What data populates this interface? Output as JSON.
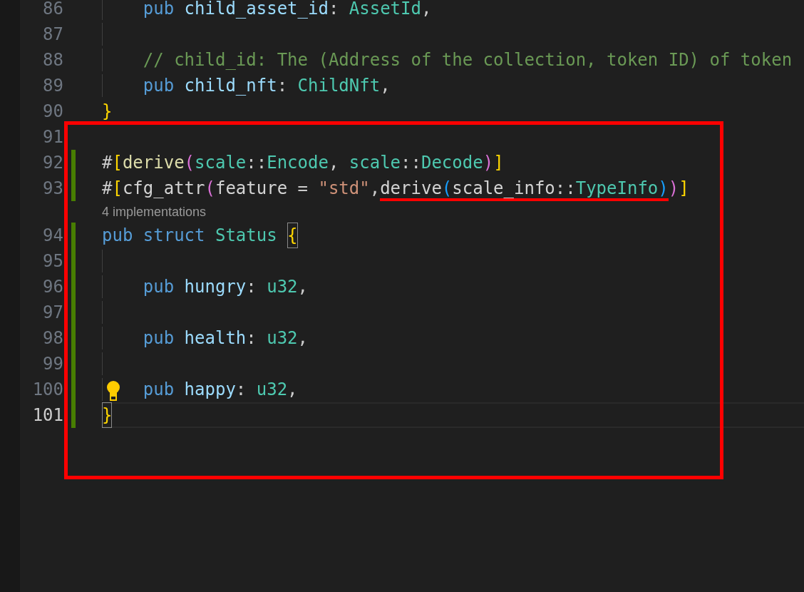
{
  "editor": {
    "rows": [
      {
        "kind": "code",
        "number": "86",
        "indented": true,
        "modified": false,
        "current": false,
        "tokens": [
          {
            "t": "pub",
            "kind": "kw"
          },
          {
            "t": "child_asset_id",
            "kind": "field",
            "gap": true
          },
          {
            "t": ":",
            "kind": "punct"
          },
          {
            "t": "AssetId",
            "kind": "type",
            "gap": true
          },
          {
            "t": ",",
            "kind": "punct"
          }
        ]
      },
      {
        "kind": "code",
        "number": "87",
        "indented": true,
        "modified": false,
        "current": false,
        "tokens": []
      },
      {
        "kind": "code",
        "number": "88",
        "indented": true,
        "modified": false,
        "current": false,
        "tokens": [
          {
            "t": "// child_id: The (Address of the collection, token ID) of token",
            "kind": "comment"
          }
        ]
      },
      {
        "kind": "code",
        "number": "89",
        "indented": true,
        "modified": false,
        "current": false,
        "tokens": [
          {
            "t": "pub",
            "kind": "kw"
          },
          {
            "t": "child_nft",
            "kind": "field",
            "gap": true
          },
          {
            "t": ":",
            "kind": "punct"
          },
          {
            "t": "ChildNft",
            "kind": "type",
            "gap": true
          },
          {
            "t": ",",
            "kind": "punct"
          }
        ]
      },
      {
        "kind": "code",
        "number": "90",
        "indented": false,
        "modified": false,
        "current": false,
        "tokens": [
          {
            "t": "}",
            "kind": "b1"
          }
        ]
      },
      {
        "kind": "code",
        "number": "91",
        "indented": false,
        "modified": false,
        "current": false,
        "tokens": []
      },
      {
        "kind": "code",
        "number": "92",
        "indented": false,
        "modified": true,
        "current": false,
        "tokens": [
          {
            "t": "#",
            "kind": "punct"
          },
          {
            "t": "[",
            "kind": "b1"
          },
          {
            "t": "derive",
            "kind": "macro"
          },
          {
            "t": "(",
            "kind": "b2"
          },
          {
            "t": "scale",
            "kind": "type"
          },
          {
            "t": "::",
            "kind": "punct"
          },
          {
            "t": "Encode",
            "kind": "type"
          },
          {
            "t": ",",
            "kind": "punct"
          },
          {
            "t": "scale",
            "kind": "type",
            "gap": true
          },
          {
            "t": "::",
            "kind": "punct"
          },
          {
            "t": "Decode",
            "kind": "type"
          },
          {
            "t": ")",
            "kind": "b2"
          },
          {
            "t": "]",
            "kind": "b1"
          }
        ]
      },
      {
        "kind": "code",
        "number": "93",
        "indented": false,
        "modified": true,
        "current": false,
        "tokens": [
          {
            "t": "#",
            "kind": "punct"
          },
          {
            "t": "[",
            "kind": "b1"
          },
          {
            "t": "cfg_attr",
            "kind": "plain"
          },
          {
            "t": "(",
            "kind": "b2"
          },
          {
            "t": "feature",
            "kind": "plain"
          },
          {
            "t": "=",
            "kind": "punct",
            "gap": true
          },
          {
            "t": "\"std\"",
            "kind": "string",
            "gap": true
          },
          {
            "t": ",",
            "kind": "punct"
          },
          {
            "t": "derive",
            "kind": "plain",
            "underlined": true
          },
          {
            "t": "(",
            "kind": "b3",
            "underlined": true
          },
          {
            "t": "scale_info",
            "kind": "plain",
            "underlined": true
          },
          {
            "t": "::",
            "kind": "punct",
            "underlined": true
          },
          {
            "t": "TypeInfo",
            "kind": "type",
            "underlined": true
          },
          {
            "t": ")",
            "kind": "b3",
            "underlined": true
          },
          {
            "t": ")",
            "kind": "b2"
          },
          {
            "t": "]",
            "kind": "b1"
          }
        ]
      },
      {
        "kind": "codelens",
        "text": "4 implementations"
      },
      {
        "kind": "code",
        "number": "94",
        "indented": false,
        "modified": true,
        "current": false,
        "tokens": [
          {
            "t": "pub",
            "kind": "kw"
          },
          {
            "t": "struct",
            "kind": "kw",
            "gap": true
          },
          {
            "t": "Status",
            "kind": "type",
            "gap": true
          },
          {
            "t": "{",
            "kind": "b1",
            "gap": true,
            "matched": true
          }
        ]
      },
      {
        "kind": "code",
        "number": "95",
        "indented": true,
        "modified": true,
        "current": false,
        "tokens": []
      },
      {
        "kind": "code",
        "number": "96",
        "indented": true,
        "modified": true,
        "current": false,
        "tokens": [
          {
            "t": "pub",
            "kind": "kw"
          },
          {
            "t": "hungry",
            "kind": "field",
            "gap": true
          },
          {
            "t": ":",
            "kind": "punct"
          },
          {
            "t": "u32",
            "kind": "type",
            "gap": true
          },
          {
            "t": ",",
            "kind": "punct"
          }
        ]
      },
      {
        "kind": "code",
        "number": "97",
        "indented": true,
        "modified": true,
        "current": false,
        "tokens": []
      },
      {
        "kind": "code",
        "number": "98",
        "indented": true,
        "modified": true,
        "current": false,
        "tokens": [
          {
            "t": "pub",
            "kind": "kw"
          },
          {
            "t": "health",
            "kind": "field",
            "gap": true
          },
          {
            "t": ":",
            "kind": "punct"
          },
          {
            "t": "u32",
            "kind": "type",
            "gap": true
          },
          {
            "t": ",",
            "kind": "punct"
          }
        ]
      },
      {
        "kind": "code",
        "number": "99",
        "indented": true,
        "modified": true,
        "current": false,
        "tokens": []
      },
      {
        "kind": "code",
        "number": "100",
        "indented": true,
        "modified": true,
        "current": false,
        "lightbulb": true,
        "tokens": [
          {
            "t": "pub",
            "kind": "kw"
          },
          {
            "t": "happy",
            "kind": "field",
            "gap": true
          },
          {
            "t": ":",
            "kind": "punct"
          },
          {
            "t": "u32",
            "kind": "type",
            "gap": true
          },
          {
            "t": ",",
            "kind": "punct"
          }
        ]
      },
      {
        "kind": "code",
        "number": "101",
        "indented": false,
        "modified": true,
        "current": true,
        "tokens": [
          {
            "t": "}",
            "kind": "b1",
            "matched": true
          }
        ]
      }
    ]
  }
}
